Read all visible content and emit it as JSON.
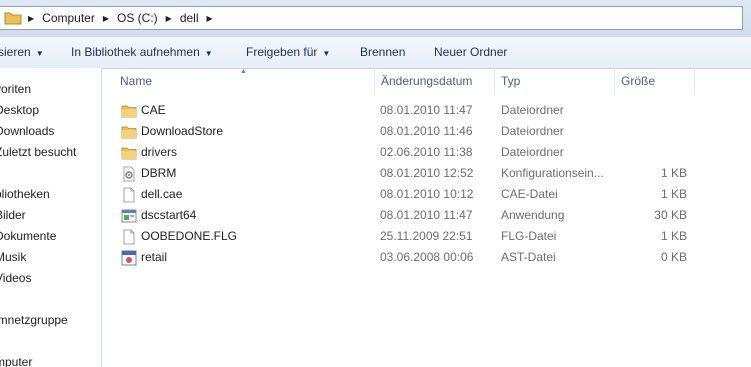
{
  "address": {
    "crumbs": [
      "Computer",
      "OS (C:)",
      "dell"
    ]
  },
  "toolbar": {
    "organize_label": "sieren",
    "library_label": "In Bibliothek aufnehmen",
    "share_label": "Freigeben für",
    "burn_label": "Brennen",
    "new_folder_label": "Neuer Ordner"
  },
  "nav": {
    "items": [
      "voriten",
      "Desktop",
      "Downloads",
      "Zuletzt besucht",
      "bliotheken",
      "Bilder",
      "Dokumente",
      "Musik",
      "Videos",
      "imnetzgruppe",
      "mputer"
    ]
  },
  "columns": {
    "name": "Name",
    "date": "Änderungsdatum",
    "type": "Typ",
    "size": "Größe"
  },
  "files": [
    {
      "name": "CAE",
      "date": "08.01.2010 11:47",
      "type": "Dateiordner",
      "size": "",
      "icon": "folder-icon"
    },
    {
      "name": "DownloadStore",
      "date": "08.01.2010 11:46",
      "type": "Dateiordner",
      "size": "",
      "icon": "folder-icon"
    },
    {
      "name": "drivers",
      "date": "02.06.2010 11:38",
      "type": "Dateiordner",
      "size": "",
      "icon": "folder-icon"
    },
    {
      "name": "DBRM",
      "date": "08.01.2010 12:52",
      "type": "Konfigurationsein...",
      "size": "1 KB",
      "icon": "config-file-icon"
    },
    {
      "name": "dell.cae",
      "date": "08.01.2010 10:12",
      "type": "CAE-Datei",
      "size": "1 KB",
      "icon": "file-icon"
    },
    {
      "name": "dscstart64",
      "date": "08.01.2010 11:47",
      "type": "Anwendung",
      "size": "30 KB",
      "icon": "application-icon"
    },
    {
      "name": "OOBEDONE.FLG",
      "date": "25.11.2009 22:51",
      "type": "FLG-Datei",
      "size": "1 KB",
      "icon": "file-icon"
    },
    {
      "name": "retail",
      "date": "03.06.2008 00:06",
      "type": "AST-Datei",
      "size": "0 KB",
      "icon": "ast-file-icon"
    }
  ],
  "colors": {
    "folder": "#e8c15a",
    "toolbar_text": "#1e3050",
    "header_text": "#4c607a",
    "secondary_text": "#6d6d6d"
  }
}
